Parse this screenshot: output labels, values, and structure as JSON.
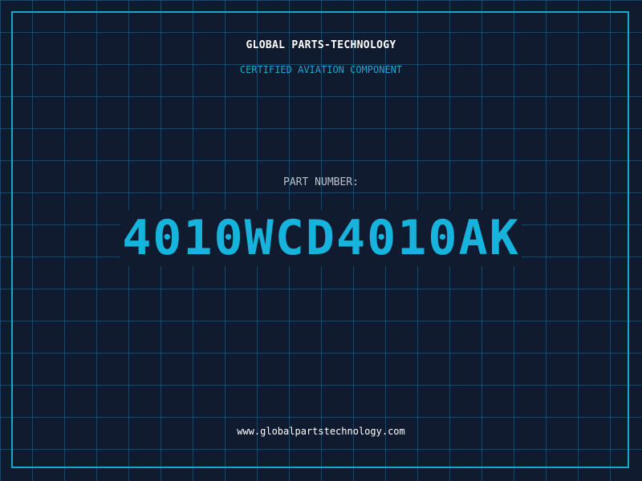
{
  "header": {
    "company_name": "GLOBAL PARTS-TECHNOLOGY",
    "subtitle": "CERTIFIED AVIATION COMPONENT"
  },
  "part": {
    "label": "PART NUMBER:",
    "number": "4010WCD4010AK"
  },
  "footer": {
    "website": "www.globalpartstechnology.com"
  },
  "colors": {
    "background": "#111b2f",
    "grid": "#1e6e96",
    "accent": "#16b4dc",
    "frame": "#1ba6d0",
    "text_primary": "#ffffff",
    "text_muted": "#b8c0cc"
  }
}
